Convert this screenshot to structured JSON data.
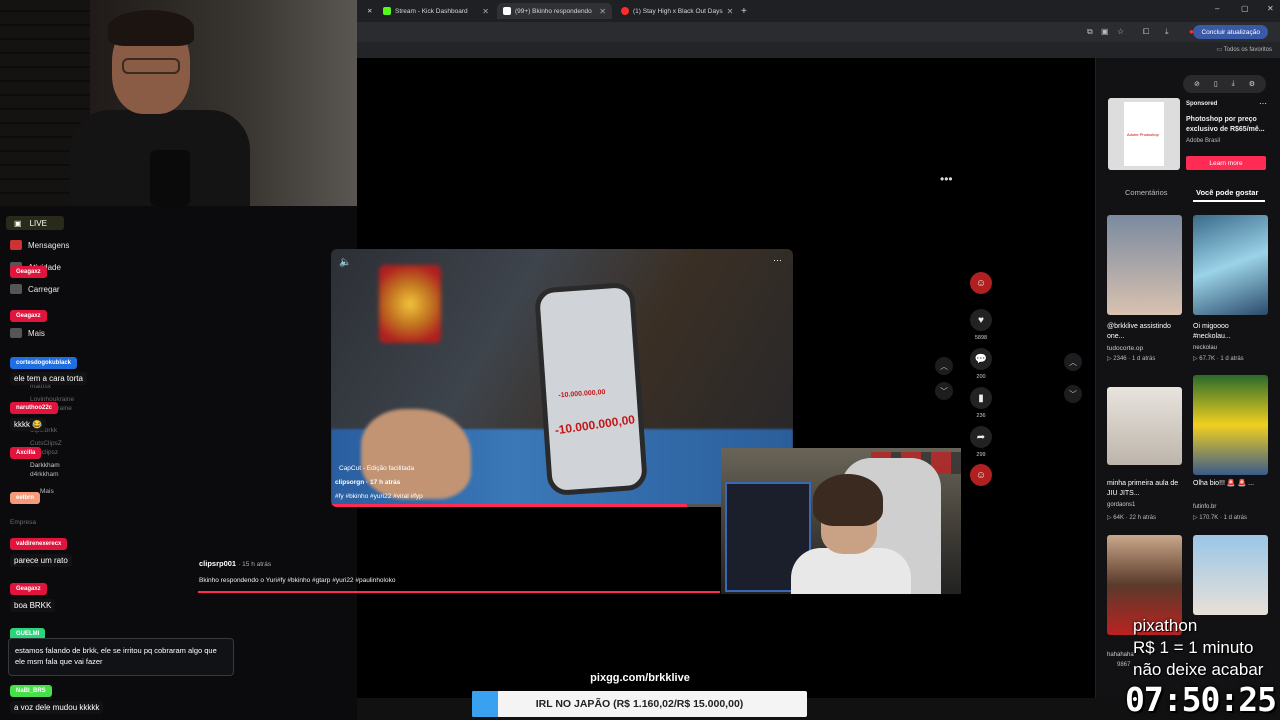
{
  "browser": {
    "tabs": [
      {
        "label": "Stream - Kick Dashboard",
        "color": "#53fc18"
      },
      {
        "label": "(99+) Bkinho respondendo",
        "color": "#ffffff"
      },
      {
        "label": "(1) Stay High x Black Out Days",
        "color": "#ff2b2b"
      }
    ],
    "update_label": "Concluir atualização",
    "bookmarks_label": "Todos os favoritos"
  },
  "sidebar": {
    "live": "LIVE",
    "items": [
      "Mensagens",
      "Atividade",
      "Carregar",
      "Mais"
    ],
    "ghost_texts": [
      "mattfsx",
      "Lovinhoukraine",
      "lovinhoukraine",
      "brkk",
      "clips.brkk",
      "CutsClipsZ",
      "cutsclipsz",
      "Darkkham",
      "d4rkkham",
      "Mais",
      "Empresa"
    ]
  },
  "chat": [
    {
      "user": "Geagaxz",
      "user_color": "#e0143c",
      "msg": ""
    },
    {
      "user": "Geagaxz",
      "user_color": "#e0143c",
      "msg": ""
    },
    {
      "user": "cortesdogokublack",
      "user_color": "#1f6fe0",
      "msg": "ele tem a cara torta"
    },
    {
      "user": "naruthoo22c",
      "user_color": "#e0143c",
      "msg": "kkkk 😂"
    },
    {
      "user": "Axcilla",
      "user_color": "#e0143c",
      "msg": ""
    },
    {
      "user": "eelbrn",
      "user_color": "#f59a7a",
      "msg": ""
    },
    {
      "user": "valdirenexerecx",
      "user_color": "#e0143c",
      "msg": "parece um rato"
    },
    {
      "user": "Geagaxz",
      "user_color": "#e0143c",
      "msg": "boa BRKK"
    },
    {
      "user": "GUELMI",
      "user_color": "#2bd67b",
      "msg": "estamos falando de brkk, ele se irritou pq cobraram algo que ele msm fala que vai fazer"
    },
    {
      "user": "NaBI_BRS",
      "user_color": "#46e048",
      "msg": "a voz dele mudou kkkkk"
    }
  ],
  "video": {
    "overlay_source": "CapCut - Edição facilitada",
    "overlay_user": "clipsorgn · 17 h atrás",
    "overlay_tags": "#fy #bkinho #yuri22 #viral #fyp",
    "phone_amount_small": "-10.000.000,00",
    "phone_amount_big": "-10.000.000,00",
    "progress": 0.77,
    "author": "clipsrp001",
    "posted": "· 15 h atrás",
    "caption": "Bkinho respondendo o Yuri#fy #bkinho #gtarp #yuri22 #paulinholoko",
    "likes": "5898",
    "comments": "200",
    "saves": "236",
    "shares": "299"
  },
  "right_panel": {
    "ad": {
      "sponsored": "Sponsored",
      "title": "Photoshop por preço exclusivo de R$65/mê...",
      "brand": "Adobe Brasil",
      "cta": "Learn more",
      "thumb_text": "Adobe Photoshop"
    },
    "tabs": [
      "Comentários",
      "Você pode gostar"
    ],
    "videos": [
      {
        "title": "@brkklive assistindo one...",
        "author": "tudocorte.op",
        "views": "2346",
        "age": "1 d atrás"
      },
      {
        "title": "Oi migoooo #neckolau...",
        "author": "neckolau",
        "views": "67.7K",
        "age": "1 d atrás"
      },
      {
        "title": "minha primeira aula de JIU JITS...",
        "author": "gordaons1",
        "views": "64K",
        "age": "22 h atrás"
      },
      {
        "title": "Olha bio!!! 🚨 🚨 ...",
        "author": "futinfo.br",
        "views": "170.7K",
        "age": "1 d atrás"
      },
      {
        "title": "hahahaha",
        "author": "9867",
        "views": "",
        "age": ""
      },
      {
        "title": "",
        "author": "",
        "views": "",
        "age": ""
      }
    ]
  },
  "stream_overlay": {
    "pix_url": "pixgg.com/brkklive",
    "goal_label": "IRL NO JAPÃO (R$ 1.160,02/R$ 15.000,00)",
    "goal_progress": 0.0773,
    "pix_lines": [
      "pixathon",
      "R$ 1 = 1 minuto",
      "não deixe acabar"
    ],
    "timer": "07:50:25"
  },
  "colors": {
    "tiktok_red": "#fe2c55",
    "goal_blue": "#3aa0f0"
  }
}
